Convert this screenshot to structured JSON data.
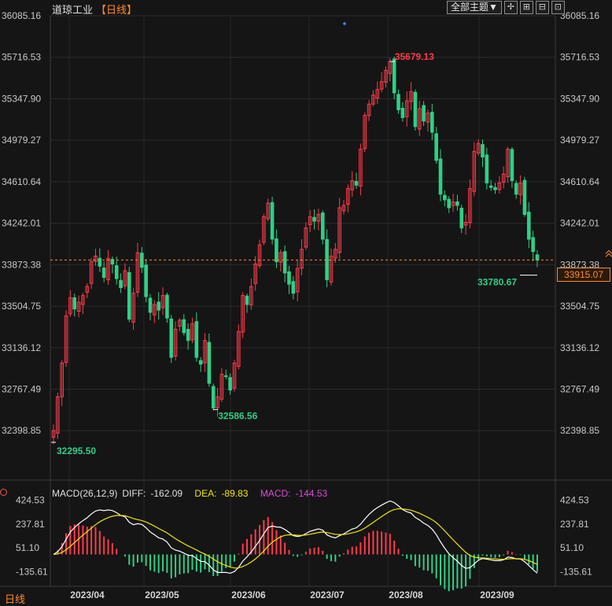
{
  "header": {
    "instrument": "道琼工业",
    "period_label": "【日线】",
    "theme_button": "全部主题▼",
    "tools": [
      "✢",
      "⊞",
      "⊟",
      "⊡"
    ]
  },
  "colors": {
    "up": "#ff3b4a",
    "down": "#2fcf86",
    "diff": "#ffffff",
    "dea": "#f2e600",
    "macd_label": "#d94bd9",
    "last_price": "#ff8a2a",
    "high_label": "#ff3b4a",
    "low_label": "#2fcf86"
  },
  "price_axis": {
    "ticks": [
      "36085.16",
      "35716.53",
      "35347.90",
      "34979.27",
      "34610.64",
      "34242.01",
      "33873.38",
      "33504.75",
      "33136.12",
      "32767.49",
      "32398.85"
    ],
    "last_price": "33915.07"
  },
  "annotations": {
    "high": "35679.13",
    "low_1": "32295.50",
    "low_2": "32586.56",
    "recent_low": "33780.67"
  },
  "macd": {
    "params": "MACD(26,12,9)",
    "diff_label": "DIFF:",
    "diff_value": "-162.09",
    "dea_label": "DEA:",
    "dea_value": "-89.83",
    "macd_label": "MACD:",
    "macd_value": "-144.53",
    "axis_ticks": [
      "424.53",
      "237.81",
      "51.10",
      "-135.61"
    ]
  },
  "footer": {
    "period": "日线"
  },
  "chart_data": {
    "type": "candlestick",
    "x_labels": [
      "2023/04",
      "2023/05",
      "2023/06",
      "2023/07",
      "2023/08",
      "2023/09"
    ],
    "ylim": [
      32030,
      36085.16
    ],
    "close_last": 33915.07,
    "high": 35679.13,
    "lows": [
      32295.5,
      32586.56,
      33780.67
    ],
    "closes": [
      32400,
      32700,
      33000,
      33420,
      33580,
      33480,
      33540,
      33600,
      33680,
      33900,
      33950,
      33860,
      33760,
      33930,
      33880,
      33750,
      33670,
      33820,
      33390,
      33620,
      33980,
      33850,
      33590,
      33450,
      33520,
      33470,
      33600,
      33400,
      33050,
      33300,
      33380,
      33270,
      33200,
      33350,
      33050,
      32990,
      33200,
      32820,
      32600,
      32700,
      32900,
      32880,
      32760,
      33000,
      33280,
      33600,
      33520,
      33680,
      33880,
      34050,
      34300,
      34420,
      34100,
      33900,
      33980,
      33800,
      33700,
      33620,
      33840,
      34010,
      34200,
      34300,
      34260,
      34320,
      34100,
      33740,
      33950,
      34010,
      34380,
      34400,
      34550,
      34620,
      34580,
      34900,
      35200,
      35300,
      35380,
      35430,
      35500,
      35600,
      35680,
      35400,
      35250,
      35180,
      35330,
      35410,
      35100,
      35260,
      35150,
      35220,
      35050,
      34800,
      34500,
      34450,
      34380,
      34430,
      34400,
      34200,
      34250,
      34550,
      34880,
      34950,
      34830,
      34600,
      34560,
      34540,
      34600,
      34680,
      34900,
      34620,
      34500,
      34600,
      34320,
      34100,
      33990,
      33915.07
    ],
    "macd_series": {
      "dif_end": -162.09,
      "dea_end": -89.83,
      "macd_end": -144.53,
      "ylim": [
        -250,
        460
      ]
    }
  }
}
